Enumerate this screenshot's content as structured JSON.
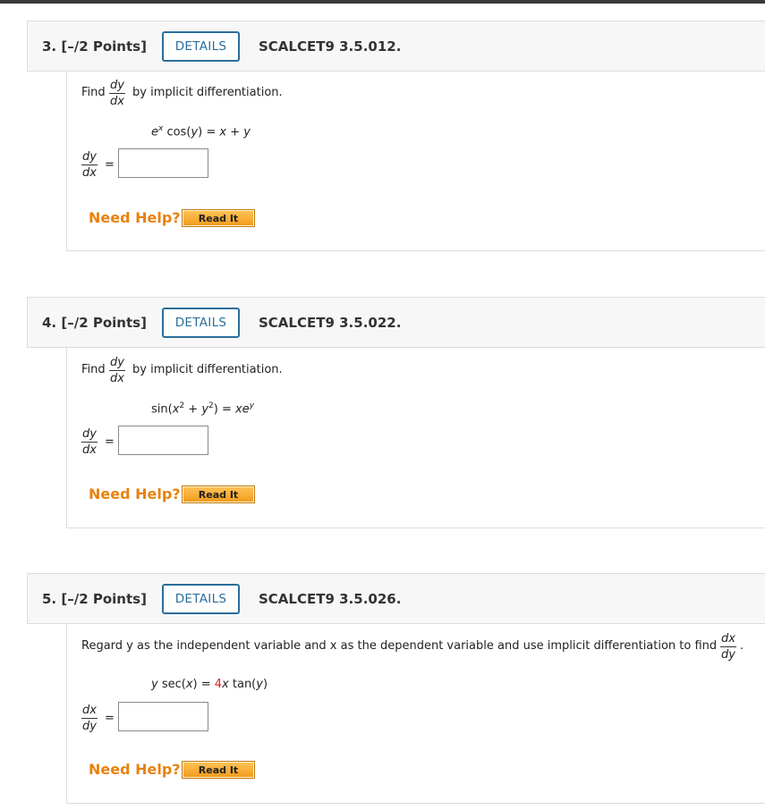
{
  "questions": [
    {
      "number": "3.",
      "points": "[–/2 Points]",
      "details_label": "DETAILS",
      "code": "SCALCET9 3.5.012.",
      "instruction_prefix": "Find",
      "instruction_suffix": "by implicit differentiation.",
      "frac_num": "dy",
      "frac_den": "dx",
      "equation": "e^x cos(y) = x + y",
      "answer_num": "dy",
      "answer_den": "dx",
      "answer_value": "",
      "need_help": "Need Help?",
      "read_it": "Read It"
    },
    {
      "number": "4.",
      "points": "[–/2 Points]",
      "details_label": "DETAILS",
      "code": "SCALCET9 3.5.022.",
      "instruction_prefix": "Find",
      "instruction_suffix": "by implicit differentiation.",
      "frac_num": "dy",
      "frac_den": "dx",
      "equation": "sin(x^2 + y^2) = xe^y",
      "answer_num": "dy",
      "answer_den": "dx",
      "answer_value": "",
      "need_help": "Need Help?",
      "read_it": "Read It"
    },
    {
      "number": "5.",
      "points": "[–/2 Points]",
      "details_label": "DETAILS",
      "code": "SCALCET9 3.5.026.",
      "instruction": "Regard y as the independent variable and x as the dependent variable and use implicit differentiation to find",
      "frac_num": "dx",
      "frac_den": "dy",
      "equation": "y sec(x) = 4x tan(y)",
      "answer_num": "dx",
      "answer_den": "dy",
      "answer_value": "",
      "need_help": "Need Help?",
      "read_it": "Read It"
    }
  ],
  "colors": {
    "accent": "#2c6e9c",
    "help": "#e8820e",
    "highlight": "#d4271b"
  }
}
